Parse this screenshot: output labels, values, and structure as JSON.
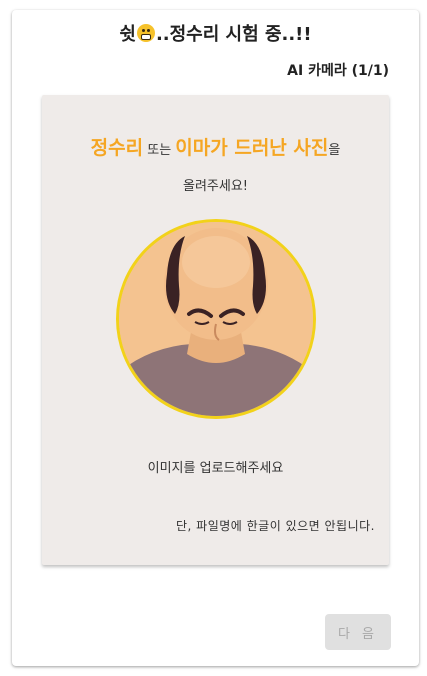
{
  "header": {
    "title_prefix": "쉿",
    "title_icon": "grimace-emoji-icon",
    "title_suffix": "..정수리 시험 중..!!",
    "camera_label": "AI 카메라 (1/1)"
  },
  "upload": {
    "headline_part1": "정수리",
    "headline_connector": " 또는 ",
    "headline_part2": "이마가 드러난 사진",
    "headline_tail": "을",
    "subline": "올려주세요!",
    "illustration": "bald-head-illustration",
    "prompt": "이미지를 업로드해주세요",
    "note": "단, 파일명에 한글이 있으면 안됩니다."
  },
  "actions": {
    "next_label": "다 음"
  },
  "colors": {
    "highlight": "#f5a623",
    "ring": "#f2d21a",
    "panel": "#efebe9",
    "button_disabled": "#e0e0e0"
  }
}
